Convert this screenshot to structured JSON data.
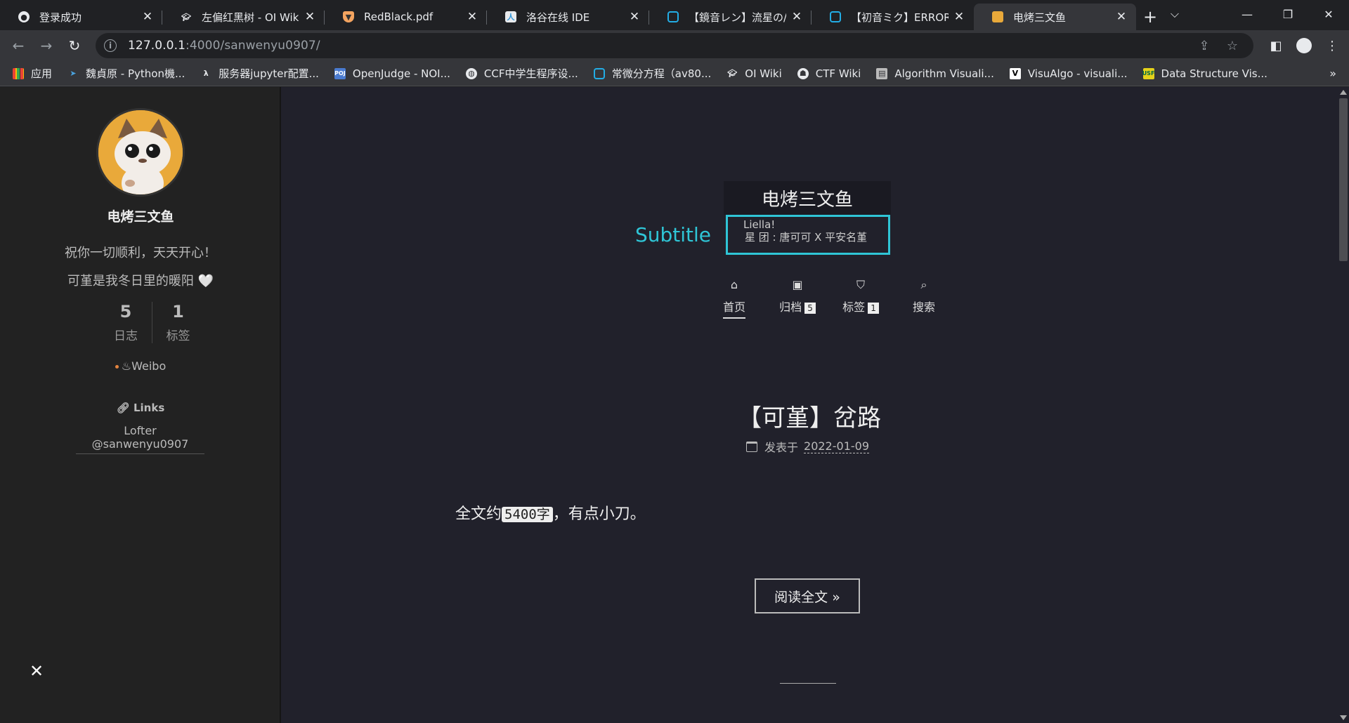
{
  "tabs": [
    {
      "title": "登录成功",
      "icon": "github-icon",
      "active": false
    },
    {
      "title": "左偏红黑树 - OI Wiki",
      "icon": "oiwiki-icon",
      "active": false
    },
    {
      "title": "RedBlack.pdf",
      "icon": "pdf-shield-icon",
      "active": false
    },
    {
      "title": "洛谷在线 IDE",
      "icon": "luogu-icon",
      "active": false
    },
    {
      "title": "【鏡音レン】流星の/",
      "icon": "bilibili-icon",
      "active": false
    },
    {
      "title": "【初音ミク】ERROR",
      "icon": "bilibili-icon",
      "active": false
    },
    {
      "title": "电烤三文鱼",
      "icon": "cat-avatar-icon",
      "active": true
    }
  ],
  "address": {
    "host": "127.0.0.1",
    "rest": ":4000/sanwenyu0907/"
  },
  "bookmarks": [
    {
      "label": "应用",
      "icon": "apps-grid-icon"
    },
    {
      "label": "魏貞原 - Python機...",
      "icon": "bird-icon"
    },
    {
      "label": "服务器jupyter配置...",
      "icon": "lambda-icon"
    },
    {
      "label": "OpenJudge - NOI...",
      "icon": "poj-icon"
    },
    {
      "label": "CCF中学生程序设...",
      "icon": "globe-icon"
    },
    {
      "label": "常微分方程（av80...",
      "icon": "bilibili-icon"
    },
    {
      "label": "OI Wiki",
      "icon": "oiwiki-icon"
    },
    {
      "label": "CTF Wiki",
      "icon": "ctf-icon"
    },
    {
      "label": "Algorithm Visuali...",
      "icon": "algo-icon"
    },
    {
      "label": "VisuAlgo - visuali...",
      "icon": "visualgo-icon"
    },
    {
      "label": "Data Structure Vis...",
      "icon": "usf-icon"
    }
  ],
  "sidebar": {
    "name": "电烤三文鱼",
    "desc1": "祝你一切顺利，天天开心！",
    "desc2": "可堇是我冬日里的暖阳 🤍",
    "stats": [
      {
        "num": "5",
        "label": "日志"
      },
      {
        "num": "1",
        "label": "标签"
      }
    ],
    "social": "Weibo",
    "links_title": "Links",
    "link": "Lofter @sanwenyu0907"
  },
  "header": {
    "brand": "电烤三文鱼",
    "subtitle": "Subtitle",
    "subtitle_box_line1": "Liella!",
    "subtitle_box_line2": "星 团 : 唐可可 X 平安名堇",
    "nav": [
      {
        "label": "首页",
        "icon": "home-icon",
        "badge": ""
      },
      {
        "label": "归档",
        "icon": "archive-icon",
        "badge": "5"
      },
      {
        "label": "标签",
        "icon": "tags-icon",
        "badge": "1"
      },
      {
        "label": "搜索",
        "icon": "search-icon",
        "badge": ""
      }
    ]
  },
  "post": {
    "title": "【可堇】岔路",
    "meta_label": "发表于",
    "date": "2022-01-09",
    "excerpt_before": "全文约",
    "excerpt_code": "5400字",
    "excerpt_after": "，有点小刀。",
    "readmore": "阅读全文 »"
  },
  "colors": {
    "accent": "#2fc5d6",
    "page_bg": "#21212b",
    "sidebar_bg": "#222222"
  }
}
